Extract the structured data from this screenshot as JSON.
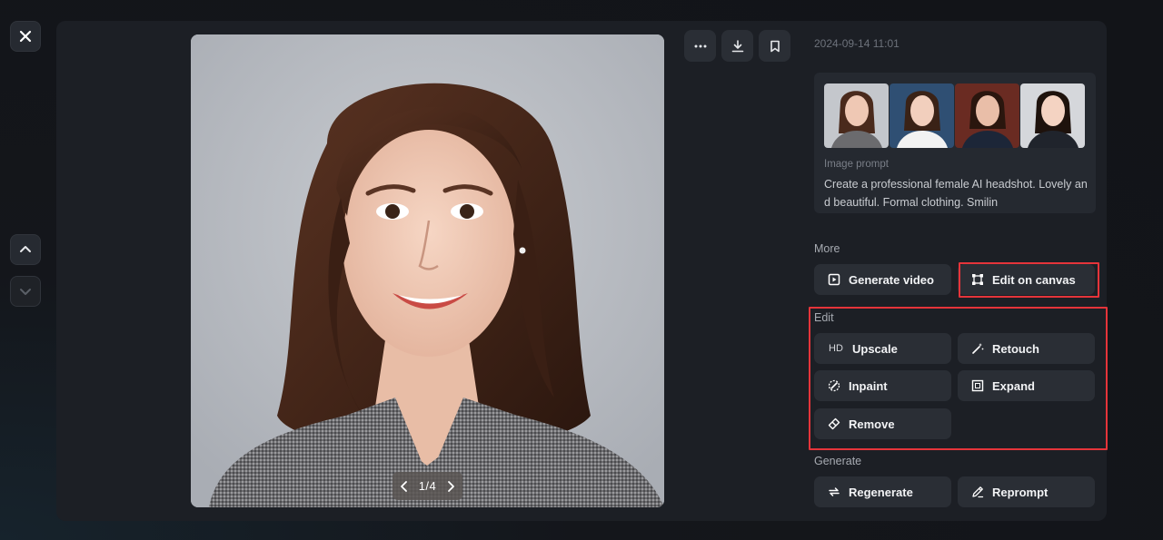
{
  "timestamp": "2024-09-14 11:01",
  "pager": {
    "current_total": "1/4"
  },
  "prompt": {
    "label": "Image prompt",
    "text": "Create a professional female AI headshot. Lovely and beautiful. Formal clothing. Smilin"
  },
  "sections": {
    "more": "More",
    "edit": "Edit",
    "generate": "Generate"
  },
  "buttons": {
    "generate_video": "Generate video",
    "edit_on_canvas": "Edit on canvas",
    "upscale": "Upscale",
    "upscale_prefix": "HD",
    "retouch": "Retouch",
    "inpaint": "Inpaint",
    "expand": "Expand",
    "remove": "Remove",
    "regenerate": "Regenerate",
    "reprompt": "Reprompt"
  },
  "colors": {
    "highlight": "#e5343a",
    "panel": "#1c1f25",
    "button": "#2a2e35"
  },
  "icons": [
    "close-icon",
    "chevron-up-icon",
    "chevron-down-icon",
    "more-icon",
    "download-icon",
    "bookmark-icon",
    "video-icon",
    "canvas-icon",
    "retouch-icon",
    "inpaint-icon",
    "expand-icon",
    "eraser-icon",
    "refresh-icon",
    "pencil-icon"
  ]
}
